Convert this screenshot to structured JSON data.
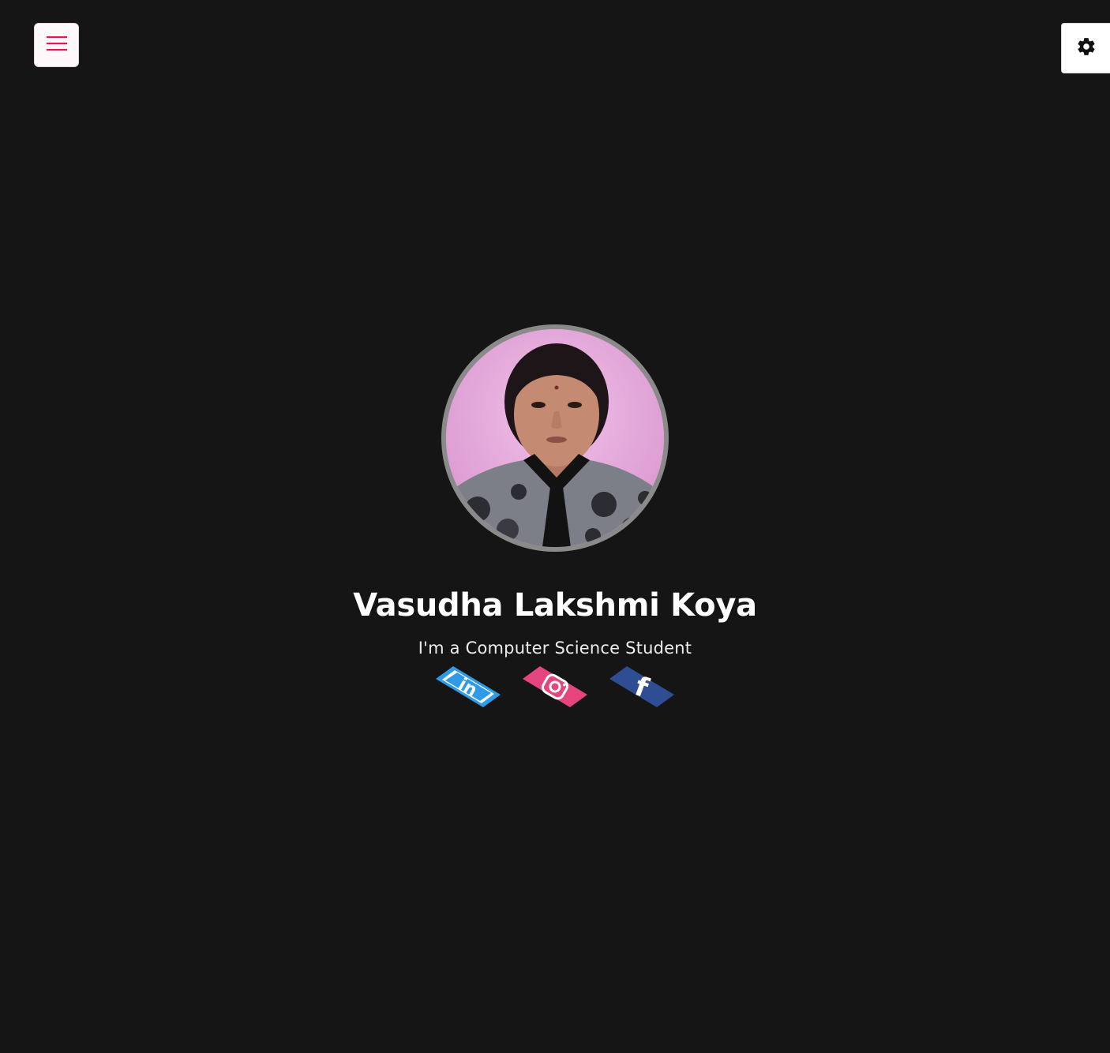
{
  "header": {
    "menu_icon": "hamburger-menu-icon",
    "settings_icon": "gear-icon",
    "accent_color": "#e8174f"
  },
  "profile": {
    "photo": "profile-photo",
    "name": "Vasudha Lakshmi Koya",
    "tagline": "I'm a Computer Science Student"
  },
  "social": [
    {
      "icon": "linkedin-icon",
      "color": "#2f9be8"
    },
    {
      "icon": "instagram-icon",
      "color": "#e4457f"
    },
    {
      "icon": "facebook-icon",
      "color": "#2e4d92"
    }
  ],
  "colors": {
    "background": "#151515",
    "text": "#ffffff"
  }
}
